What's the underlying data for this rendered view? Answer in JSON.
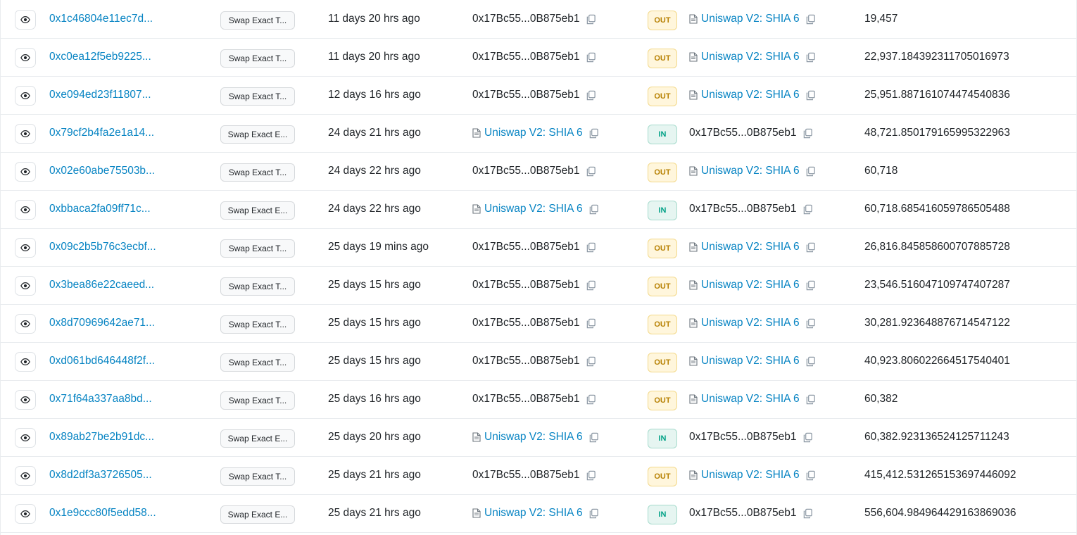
{
  "columns": {
    "address_label": "0x17Bc55...0B875eb1",
    "contract_label": "Uniswap V2: SHIA 6"
  },
  "icons": {
    "view": "eye-icon",
    "contract": "document-icon",
    "copy": "copy-icon"
  },
  "colors": {
    "link": "#0784c3",
    "out_bg": "#fff6dc",
    "out_text": "#b78103",
    "in_bg": "#e6f5f1",
    "in_text": "#00a186"
  },
  "rows": [
    {
      "hash": "0x1c46804e11ec7d...",
      "method": "Swap Exact T...",
      "age": "11 days 20 hrs ago",
      "direction": "OUT",
      "amount": "19,457"
    },
    {
      "hash": "0xc0ea12f5eb9225...",
      "method": "Swap Exact T...",
      "age": "11 days 20 hrs ago",
      "direction": "OUT",
      "amount": "22,937.184392311705016973"
    },
    {
      "hash": "0xe094ed23f11807...",
      "method": "Swap Exact T...",
      "age": "12 days 16 hrs ago",
      "direction": "OUT",
      "amount": "25,951.887161074474540836"
    },
    {
      "hash": "0x79cf2b4fa2e1a14...",
      "method": "Swap Exact E...",
      "age": "24 days 21 hrs ago",
      "direction": "IN",
      "amount": "48,721.850179165995322963"
    },
    {
      "hash": "0x02e60abe75503b...",
      "method": "Swap Exact T...",
      "age": "24 days 22 hrs ago",
      "direction": "OUT",
      "amount": "60,718"
    },
    {
      "hash": "0xbbaca2fa09ff71c...",
      "method": "Swap Exact E...",
      "age": "24 days 22 hrs ago",
      "direction": "IN",
      "amount": "60,718.685416059786505488"
    },
    {
      "hash": "0x09c2b5b76c3ecbf...",
      "method": "Swap Exact T...",
      "age": "25 days 19 mins ago",
      "direction": "OUT",
      "amount": "26,816.845858600707885728"
    },
    {
      "hash": "0x3bea86e22caeed...",
      "method": "Swap Exact T...",
      "age": "25 days 15 hrs ago",
      "direction": "OUT",
      "amount": "23,546.516047109747407287"
    },
    {
      "hash": "0x8d70969642ae71...",
      "method": "Swap Exact T...",
      "age": "25 days 15 hrs ago",
      "direction": "OUT",
      "amount": "30,281.923648876714547122"
    },
    {
      "hash": "0xd061bd646448f2f...",
      "method": "Swap Exact T...",
      "age": "25 days 15 hrs ago",
      "direction": "OUT",
      "amount": "40,923.806022664517540401"
    },
    {
      "hash": "0x71f64a337aa8bd...",
      "method": "Swap Exact T...",
      "age": "25 days 16 hrs ago",
      "direction": "OUT",
      "amount": "60,382"
    },
    {
      "hash": "0x89ab27be2b91dc...",
      "method": "Swap Exact E...",
      "age": "25 days 20 hrs ago",
      "direction": "IN",
      "amount": "60,382.923136524125711243"
    },
    {
      "hash": "0x8d2df3a3726505...",
      "method": "Swap Exact T...",
      "age": "25 days 21 hrs ago",
      "direction": "OUT",
      "amount": "415,412.531265153697446092"
    },
    {
      "hash": "0x1e9ccc80f5edd58...",
      "method": "Swap Exact E...",
      "age": "25 days 21 hrs ago",
      "direction": "IN",
      "amount": "556,604.984964429163869036"
    }
  ]
}
